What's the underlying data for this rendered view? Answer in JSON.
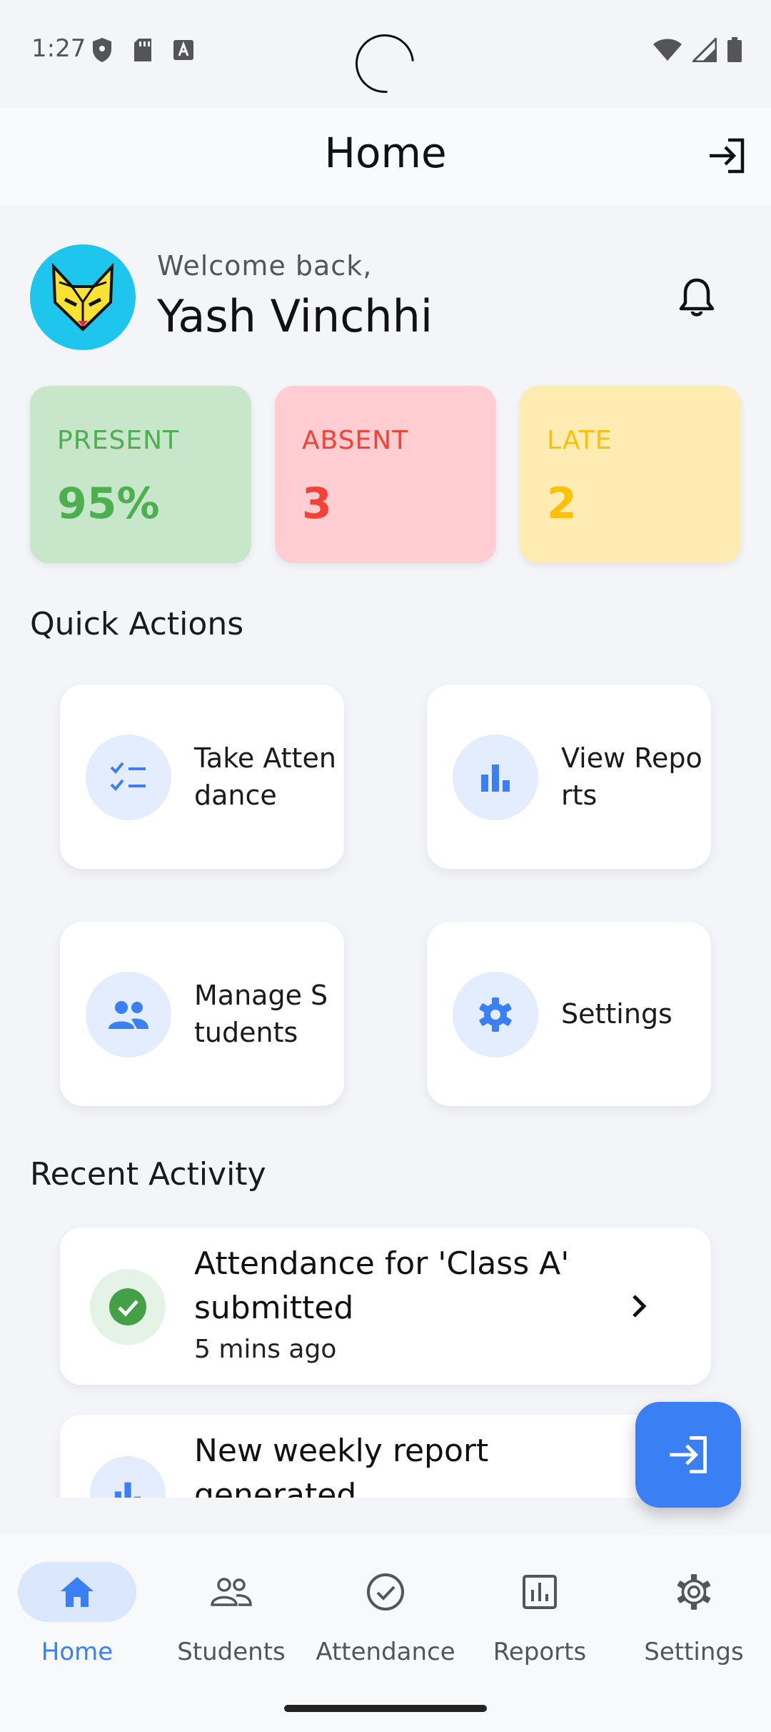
{
  "status_bar": {
    "time": "1:27"
  },
  "app_bar": {
    "title": "Home"
  },
  "greeting": {
    "welcome": "Welcome back,",
    "name": "Yash Vinchhi"
  },
  "stats": [
    {
      "label": "PRESENT",
      "value": "95%",
      "bg": "#c8e6c9",
      "color": "#4caf50"
    },
    {
      "label": "ABSENT",
      "value": "3",
      "bg": "#ffcdd2",
      "color": "#f44336"
    },
    {
      "label": "LATE",
      "value": "2",
      "bg": "#ffecb3",
      "color": "#ffc107"
    }
  ],
  "quick_actions": {
    "title": "Quick Actions",
    "items": [
      {
        "label": "Take Attendance",
        "icon": "checklist-icon"
      },
      {
        "label": "View Reports",
        "icon": "bar-chart-icon"
      },
      {
        "label": "Manage Students",
        "icon": "people-icon"
      },
      {
        "label": "Settings",
        "icon": "gear-icon"
      }
    ]
  },
  "recent_activity": {
    "title": "Recent Activity",
    "items": [
      {
        "title": "Attendance for 'Class A' submitted",
        "time": "5 mins ago",
        "icon": "check-circle-icon"
      },
      {
        "title": "New weekly report generated",
        "time": "",
        "icon": "bar-chart-icon"
      }
    ]
  },
  "bottom_nav": [
    {
      "label": "Home",
      "icon": "home-icon",
      "active": true
    },
    {
      "label": "Students",
      "icon": "people-outline-icon",
      "active": false
    },
    {
      "label": "Attendance",
      "icon": "check-circle-outline-icon",
      "active": false
    },
    {
      "label": "Reports",
      "icon": "report-icon",
      "active": false
    },
    {
      "label": "Settings",
      "icon": "gear-icon",
      "active": false
    }
  ],
  "colors": {
    "accent": "#3b7ff5",
    "accent_light": "#e4edfd"
  }
}
